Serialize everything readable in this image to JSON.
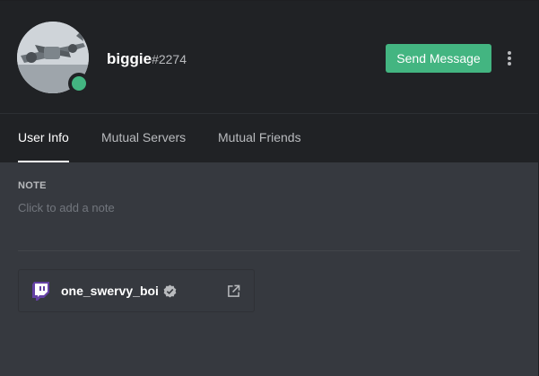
{
  "profile": {
    "username": "biggie",
    "discriminator": "#2274",
    "status_color": "#43b581",
    "send_message_label": "Send Message",
    "more_icon": "more-vertical-icon"
  },
  "tabs": [
    {
      "label": "User Info",
      "active": true
    },
    {
      "label": "Mutual Servers",
      "active": false
    },
    {
      "label": "Mutual Friends",
      "active": false
    }
  ],
  "note": {
    "heading": "NOTE",
    "placeholder": "Click to add a note"
  },
  "connected_account": {
    "platform_icon": "twitch-icon",
    "name": "one_swervy_boi",
    "verified_icon": "verified-check-icon",
    "open_icon": "external-link-icon"
  },
  "colors": {
    "accent_green": "#43b581",
    "twitch_purple": "#6441a4",
    "header_bg": "#202225",
    "body_bg": "#36393f"
  }
}
